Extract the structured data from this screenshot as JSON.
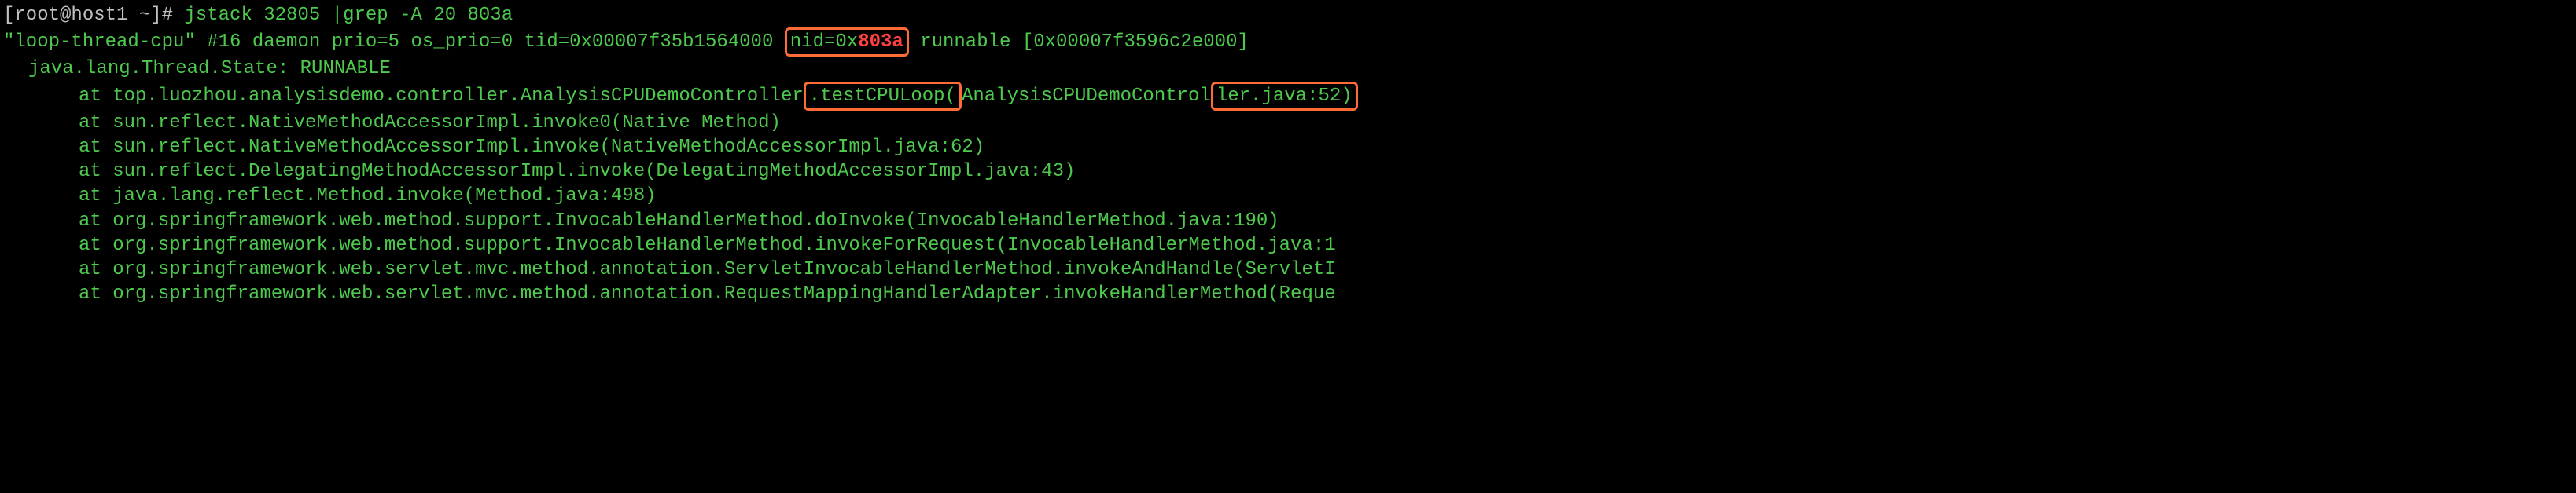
{
  "terminal": {
    "prompt_user": "[root@host1 ~]# ",
    "command": "jstack 32805 |grep -A 20 803a",
    "line1_pre": "\"loop-thread-cpu\" #16 daemon prio=5 os_prio=0 tid=0x00007f35b1564000 ",
    "line1_box_pre": "nid=0x",
    "line1_box_hl": "803a",
    "line1_post": " runnable [0x00007f3596c2e000]",
    "line2": "java.lang.Thread.State: RUNNABLE",
    "line3_pre": "at top.luozhou.analysisdemo.controller.AnalysisCPUDemoController",
    "line3_box1": ".testCPULoop(",
    "line3_mid": "AnalysisCPUDemoControl",
    "line3_box2": "ler.java:52)",
    "line4": "at sun.reflect.NativeMethodAccessorImpl.invoke0(Native Method)",
    "line5": "at sun.reflect.NativeMethodAccessorImpl.invoke(NativeMethodAccessorImpl.java:62)",
    "line6": "at sun.reflect.DelegatingMethodAccessorImpl.invoke(DelegatingMethodAccessorImpl.java:43)",
    "line7": "at java.lang.reflect.Method.invoke(Method.java:498)",
    "line8": "at org.springframework.web.method.support.InvocableHandlerMethod.doInvoke(InvocableHandlerMethod.java:190)",
    "line9": "at org.springframework.web.method.support.InvocableHandlerMethod.invokeForRequest(InvocableHandlerMethod.java:1",
    "line10": "at org.springframework.web.servlet.mvc.method.annotation.ServletInvocableHandlerMethod.invokeAndHandle(ServletI",
    "line11": "at org.springframework.web.servlet.mvc.method.annotation.RequestMappingHandlerAdapter.invokeHandlerMethod(Reque"
  }
}
